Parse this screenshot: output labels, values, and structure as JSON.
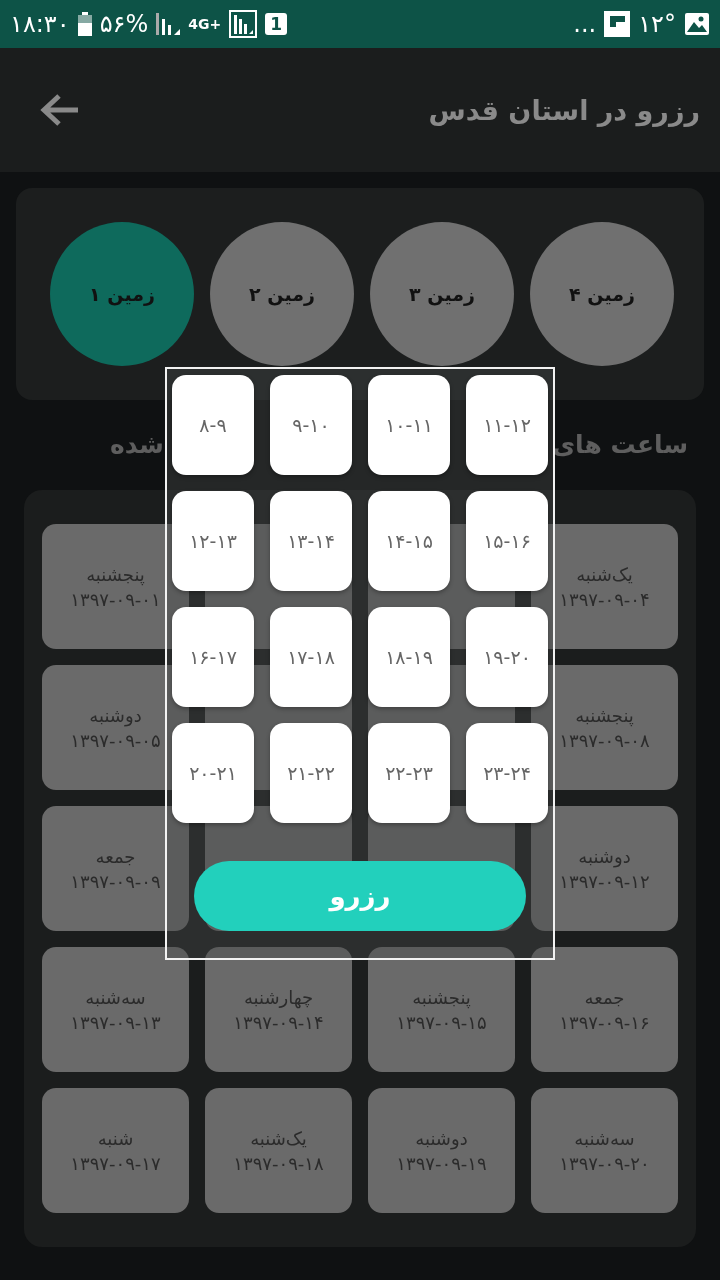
{
  "status_bar": {
    "time": "۱۸:۳۰",
    "battery": "۵۶%",
    "network": "4G+",
    "sim": "1",
    "more": "...",
    "temperature": "۱۲°"
  },
  "header": {
    "title": "رزرو در استان قدس"
  },
  "tabs": [
    {
      "label": "زمین ۴",
      "selected": false
    },
    {
      "label": "زمین ۳",
      "selected": false
    },
    {
      "label": "زمین ۲",
      "selected": false
    },
    {
      "label": "زمین ۱",
      "selected": true
    }
  ],
  "section_title": {
    "right_part": "ساعت های",
    "left_part": "شده"
  },
  "days": [
    {
      "kind": "date",
      "day": "یک‌شنبه",
      "date": "۱۳۹۷-۰۹-۰۴"
    },
    {
      "kind": "covered"
    },
    {
      "kind": "covered"
    },
    {
      "kind": "date",
      "day": "پنجشنبه",
      "date": "۱۳۹۷-۰۹-۰۱"
    },
    {
      "kind": "date",
      "day": "پنجشنبه",
      "date": "۱۳۹۷-۰۹-۰۸"
    },
    {
      "kind": "covered"
    },
    {
      "kind": "covered"
    },
    {
      "kind": "date",
      "day": "دوشنبه",
      "date": "۱۳۹۷-۰۹-۰۵"
    },
    {
      "kind": "date",
      "day": "دوشنبه",
      "date": "۱۳۹۷-۰۹-۱۲"
    },
    {
      "kind": "covered"
    },
    {
      "kind": "covered"
    },
    {
      "kind": "date",
      "day": "جمعه",
      "date": "۱۳۹۷-۰۹-۰۹"
    },
    {
      "kind": "date",
      "day": "جمعه",
      "date": "۱۳۹۷-۰۹-۱۶"
    },
    {
      "kind": "date",
      "day": "پنجشنبه",
      "date": "۱۳۹۷-۰۹-۱۵"
    },
    {
      "kind": "date",
      "day": "چهارشنبه",
      "date": "۱۳۹۷-۰۹-۱۴"
    },
    {
      "kind": "date",
      "day": "سه‌شنبه",
      "date": "۱۳۹۷-۰۹-۱۳"
    },
    {
      "kind": "date",
      "day": "سه‌شنبه",
      "date": "۱۳۹۷-۰۹-۲۰"
    },
    {
      "kind": "date",
      "day": "دوشنبه",
      "date": "۱۳۹۷-۰۹-۱۹"
    },
    {
      "kind": "date",
      "day": "یک‌شنبه",
      "date": "۱۳۹۷-۰۹-۱۸"
    },
    {
      "kind": "date",
      "day": "شنبه",
      "date": "۱۳۹۷-۰۹-۱۷"
    }
  ],
  "dialog": {
    "slots": [
      "۱۱-۱۲",
      "۱۰-۱۱",
      "۹-۱۰",
      "۸-۹",
      "۱۵-۱۶",
      "۱۴-۱۵",
      "۱۳-۱۴",
      "۱۲-۱۳",
      "۱۹-۲۰",
      "۱۸-۱۹",
      "۱۷-۱۸",
      "۱۶-۱۷",
      "۲۳-۲۴",
      "۲۲-۲۳",
      "۲۱-۲۲",
      "۲۰-۲۱"
    ],
    "button": "رزرو"
  }
}
